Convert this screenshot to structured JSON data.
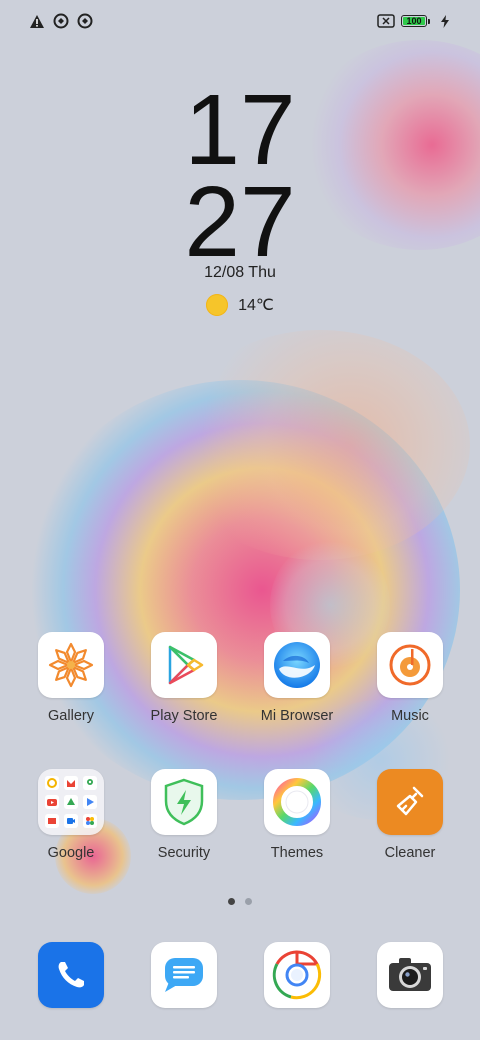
{
  "status_bar": {
    "left_icons": [
      "alert-triangle-icon",
      "data-saver-icon",
      "data-saver-icon"
    ],
    "right_icons": [
      "no-sim-icon",
      "battery-icon",
      "charging-bolt-icon"
    ],
    "battery_level": "100",
    "battery_color": "#2fc94a"
  },
  "lock": {
    "hours": "17",
    "minutes": "27",
    "date": "12/08 Thu",
    "temperature": "14℃",
    "weather_icon": "sun-icon"
  },
  "apps_row1": [
    {
      "label": "Gallery",
      "icon": "gallery-flower-icon"
    },
    {
      "label": "Play Store",
      "icon": "play-store-icon"
    },
    {
      "label": "Mi Browser",
      "icon": "mi-browser-icon"
    },
    {
      "label": "Music",
      "icon": "music-disc-icon"
    }
  ],
  "apps_row2": [
    {
      "label": "Google",
      "icon": "google-folder-icon"
    },
    {
      "label": "Security",
      "icon": "security-shield-icon"
    },
    {
      "label": "Themes",
      "icon": "themes-ring-icon"
    },
    {
      "label": "Cleaner",
      "icon": "cleaner-brush-icon"
    }
  ],
  "page_indicator": {
    "pages": 2,
    "current": 1
  },
  "dock": [
    {
      "name": "phone",
      "icon": "phone-icon"
    },
    {
      "name": "messages",
      "icon": "messages-icon"
    },
    {
      "name": "chrome",
      "icon": "chrome-icon"
    },
    {
      "name": "camera",
      "icon": "camera-icon"
    }
  ],
  "colors": {
    "background": "#ccd0da",
    "cleaner_orange": "#ec8a22",
    "phone_blue": "#1a73e8",
    "security_green": "#3fbf5a"
  }
}
